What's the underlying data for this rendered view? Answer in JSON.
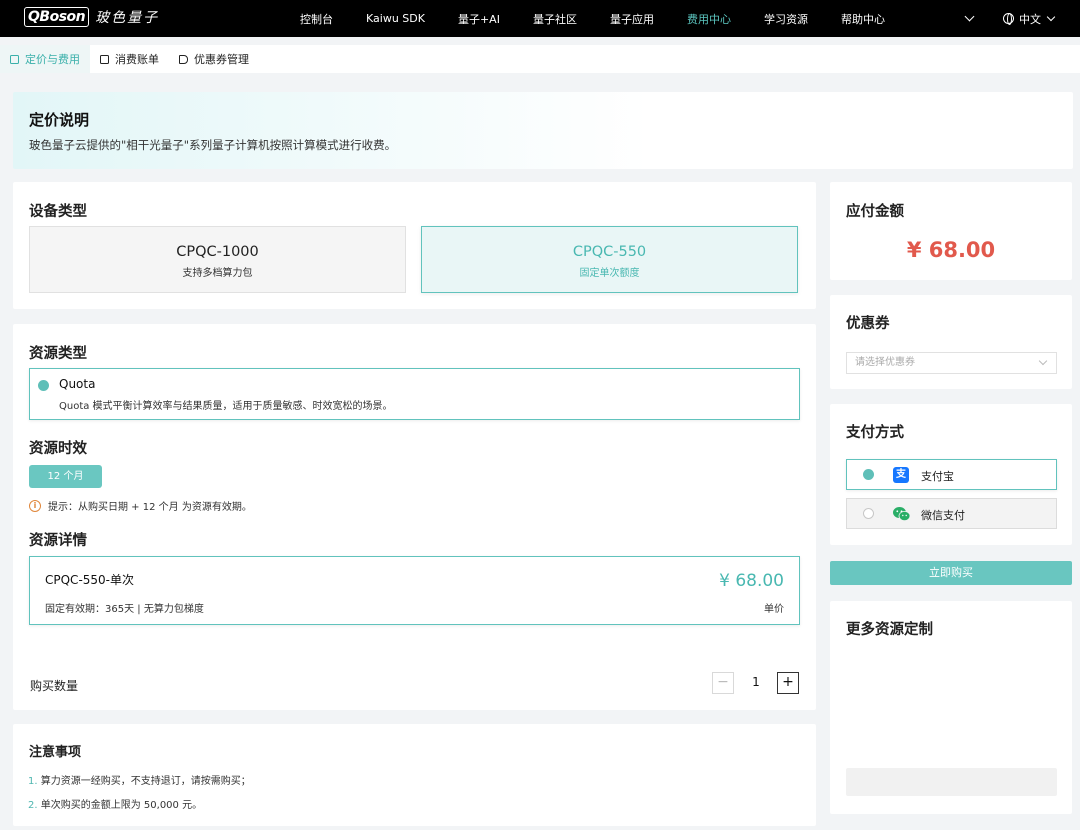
{
  "nav": {
    "logo_mark": "QBoson",
    "logo_text": "玻色量子",
    "items": [
      {
        "label": "控制台"
      },
      {
        "label": "Kaiwu SDK"
      },
      {
        "label": "量子+AI"
      },
      {
        "label": "量子社区"
      },
      {
        "label": "量子应用"
      },
      {
        "label": "费用中心"
      },
      {
        "label": "学习资源"
      },
      {
        "label": "帮助中心"
      }
    ],
    "active_item": "费用中心",
    "language": "中文"
  },
  "subtabs": [
    {
      "label": "定价与费用"
    },
    {
      "label": "消费账单"
    },
    {
      "label": "优惠券管理"
    }
  ],
  "banner": {
    "title": "定价说明",
    "description": "玻色量子云提供的\"相干光量子\"系列量子计算机按照计算模式进行收费。"
  },
  "device": {
    "title": "设备类型",
    "options": [
      {
        "name": "CPQC-1000",
        "sub": "支持多档算力包"
      },
      {
        "name": "CPQC-550",
        "sub": "固定单次额度"
      }
    ],
    "selected": "CPQC-550"
  },
  "resource": {
    "type_title": "资源类型",
    "quota_title": "Quota",
    "quota_desc": "Quota 模式平衡计算效率与结果质量，适用于质量敏感、时效宽松的场景。",
    "term_title": "资源时效",
    "term_button": "12 个月",
    "hint": "提示：从购买日期 + 12 个月 为资源有效期。",
    "detail_title": "资源详情",
    "detail_name": "CPQC-550-单次",
    "detail_desc": "固定有效期：365天 | 无算力包梯度",
    "detail_price": "¥ 68.00",
    "detail_unit": "单价",
    "qty_label": "购买数量",
    "qty_minus": "−",
    "qty_value": "1",
    "qty_plus": "+"
  },
  "notes": {
    "title": "注意事项",
    "items": [
      {
        "num": "1.",
        "text": "算力资源一经购买，不支持退订，请按需购买；"
      },
      {
        "num": "2.",
        "text": "单次购买的金额上限为 50,000 元。"
      }
    ]
  },
  "summary": {
    "amount_title": "应付金额",
    "amount": "¥ 68.00",
    "coupon_title": "优惠券",
    "coupon_placeholder": "请选择优惠券",
    "payment_title": "支付方式",
    "payment_options": [
      {
        "label": "支付宝",
        "icon_char": "支"
      },
      {
        "label": "微信支付"
      }
    ],
    "selected_payment": "支付宝",
    "buy_button": "立即购买",
    "more_title": "更多资源定制"
  },
  "colors": {
    "accent": "#61c3bd",
    "price_red": "#e1594c",
    "alipay_blue": "#1677ff",
    "wechat_green": "#2aae67"
  }
}
